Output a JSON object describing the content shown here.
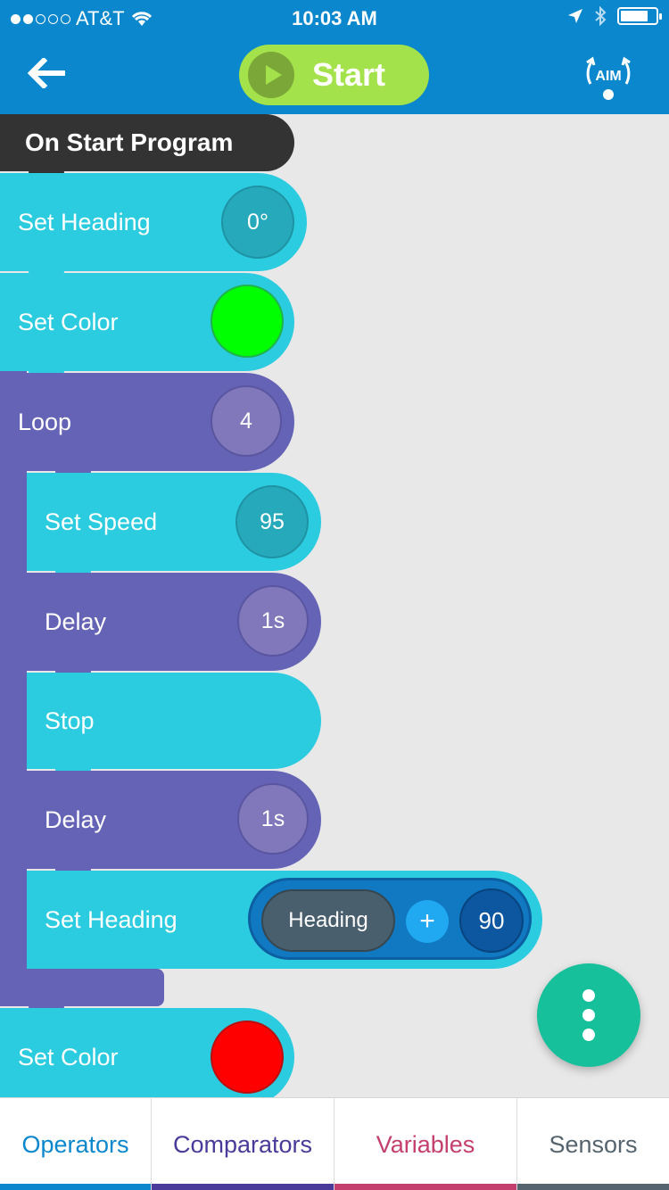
{
  "status_bar": {
    "carrier": "AT&T",
    "time": "10:03 AM"
  },
  "header": {
    "start_label": "Start",
    "aim_label": "AIM"
  },
  "program": {
    "hat_label": "On Start Program",
    "blocks": [
      {
        "label": "Set Heading",
        "value": "0°"
      },
      {
        "label": "Set Color",
        "color": "#00ff00"
      },
      {
        "label": "Loop",
        "value": "4"
      },
      {
        "label": "Set Speed",
        "value": "95"
      },
      {
        "label": "Delay",
        "value": "1s"
      },
      {
        "label": "Stop"
      },
      {
        "label": "Delay",
        "value": "1s"
      },
      {
        "label": "Set Heading",
        "expression": {
          "variable": "Heading",
          "operator": "+",
          "operand": "90"
        }
      },
      {
        "label": "Set Color",
        "color": "#ff0000"
      }
    ]
  },
  "tabs": [
    {
      "label": "Operators",
      "color": "#0a87cd"
    },
    {
      "label": "Comparators",
      "color": "#4a3a9a"
    },
    {
      "label": "Variables",
      "color": "#c43e6e"
    },
    {
      "label": "Sensors",
      "color": "#55646e"
    }
  ],
  "colors": {
    "cyan_block": "#2bcbe0",
    "purple_block": "#6563b5",
    "header_bg": "#0a87cd",
    "start_button": "#a3e24a",
    "fab": "#16c09b"
  }
}
